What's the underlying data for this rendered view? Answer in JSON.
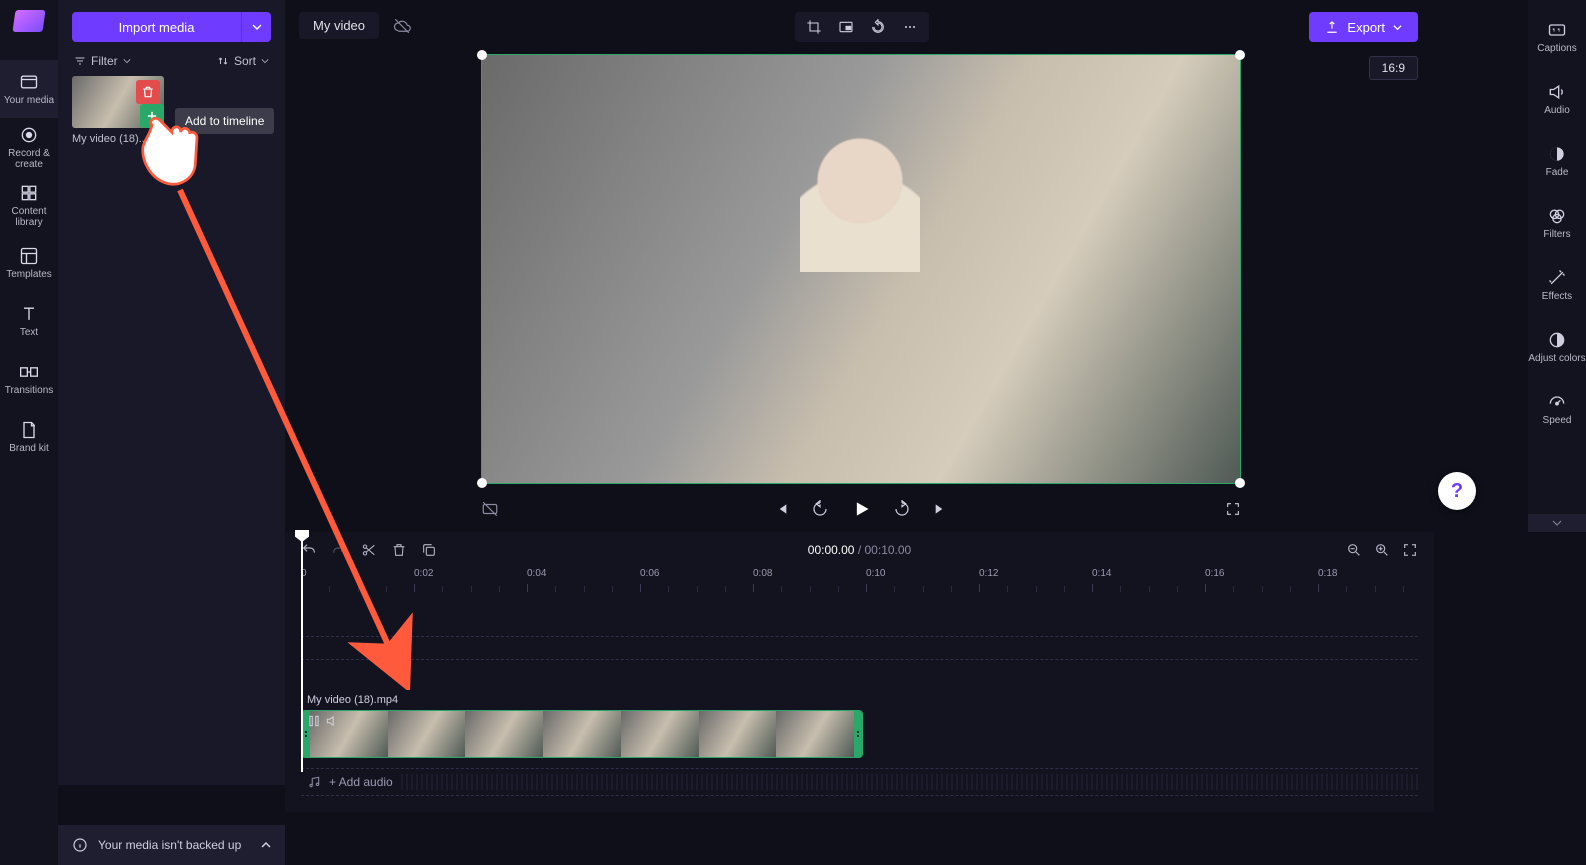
{
  "app": {
    "title": "My video"
  },
  "import_label": "Import media",
  "filter_label": "Filter",
  "sort_label": "Sort",
  "media": {
    "items": [
      {
        "name": "My video (18)...."
      }
    ]
  },
  "tooltip": "Add to timeline",
  "left_rail": [
    {
      "id": "your-media",
      "label": "Your media"
    },
    {
      "id": "record-create",
      "label": "Record & create"
    },
    {
      "id": "content-lib",
      "label": "Content library"
    },
    {
      "id": "templates",
      "label": "Templates"
    },
    {
      "id": "text",
      "label": "Text"
    },
    {
      "id": "transitions",
      "label": "Transitions"
    },
    {
      "id": "brand-kit",
      "label": "Brand kit"
    }
  ],
  "prop_rail": [
    {
      "id": "captions",
      "label": "Captions"
    },
    {
      "id": "audio",
      "label": "Audio"
    },
    {
      "id": "fade",
      "label": "Fade"
    },
    {
      "id": "filters",
      "label": "Filters"
    },
    {
      "id": "effects",
      "label": "Effects"
    },
    {
      "id": "adjust",
      "label": "Adjust colors"
    },
    {
      "id": "speed",
      "label": "Speed"
    }
  ],
  "export_label": "Export",
  "aspect_ratio": "16:9",
  "time": {
    "current": "00:00.00",
    "sep": " / ",
    "total": "00:10.00"
  },
  "ruler_ticks": [
    "0",
    "0:02",
    "0:04",
    "0:06",
    "0:08",
    "0:10",
    "0:12",
    "0:14",
    "0:16",
    "0:18"
  ],
  "clip": {
    "name": "My video (18).mp4"
  },
  "add_audio": "+ Add audio",
  "backup_msg": "Your media isn't backed up",
  "help": "?"
}
